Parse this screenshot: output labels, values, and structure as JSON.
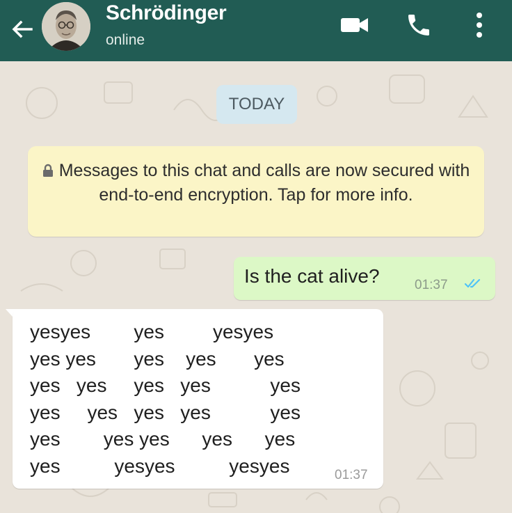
{
  "header": {
    "contact_name": "Schrödinger",
    "status": "online",
    "icons": [
      "back-arrow-icon",
      "video-camera-icon",
      "phone-icon",
      "more-vertical-icon"
    ]
  },
  "chat": {
    "date_label": "TODAY",
    "encryption_notice": "Messages to this chat and calls are now secured with end-to-end encryption. Tap for more info.",
    "messages": [
      {
        "direction": "outgoing",
        "text": "Is the cat alive?",
        "time": "01:37",
        "status": "read"
      },
      {
        "direction": "incoming",
        "lines": [
          "yesyes        yes         yesyes",
          "yes yes       yes    yes       yes",
          "yes   yes     yes   yes           yes",
          "yes     yes   yes   yes           yes",
          "yes        yes yes      yes      yes",
          "yes          yesyes          yesyes"
        ],
        "time": "01:37"
      }
    ]
  },
  "colors": {
    "header": "#215c54",
    "wallpaper": "#e9e3da",
    "outgoing_bubble": "#dcf8c6",
    "incoming_bubble": "#ffffff",
    "notice_bubble": "#fbf5c7",
    "date_chip": "#d5e8f0",
    "read_ticks": "#4fc3f7"
  }
}
